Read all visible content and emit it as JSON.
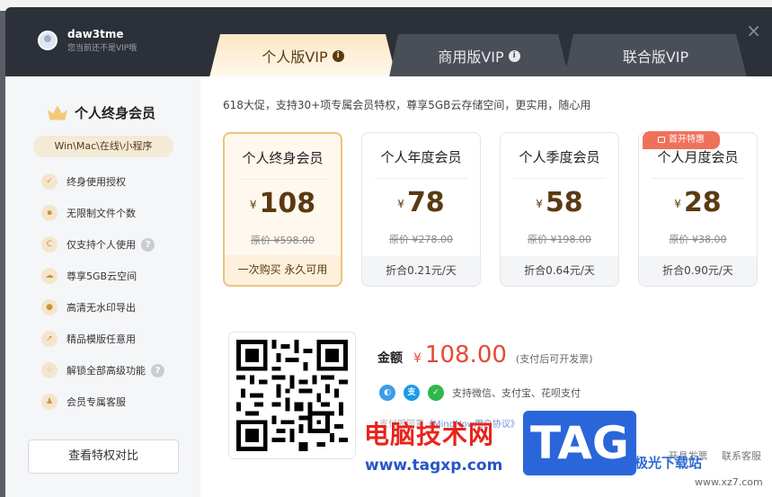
{
  "user": {
    "name": "daw3tme",
    "status": "您当前还不是VIP哦"
  },
  "tabs": [
    {
      "label": "个人版VIP",
      "info": "i"
    },
    {
      "label": "商用版VIP",
      "info": "i"
    },
    {
      "label": "联合版VIP"
    }
  ],
  "close_label": "×",
  "sidebar": {
    "title": "个人终身会员",
    "platform": "Win\\Mac\\在线\\小程序",
    "features": [
      {
        "label": "终身使用授权",
        "icon": "shield-check-icon",
        "help": false
      },
      {
        "label": "无限制文件个数",
        "icon": "lock-icon",
        "help": false
      },
      {
        "label": "仅支持个人使用",
        "icon": "copyright-icon",
        "help": true
      },
      {
        "label": "尊享5GB云空间",
        "icon": "cloud-icon",
        "help": false
      },
      {
        "label": "高清无水印导出",
        "icon": "drop-icon",
        "help": false
      },
      {
        "label": "精品模版任意用",
        "icon": "rocket-icon",
        "help": false
      },
      {
        "label": "解锁全部高级功能",
        "icon": "grid-icon",
        "help": true
      },
      {
        "label": "会员专属客服",
        "icon": "user-icon",
        "help": false
      }
    ],
    "help_mark": "?",
    "compare_button": "查看特权对比"
  },
  "promo": "618大促，支持30+项专属会员特权，尊享5GB云存储空间，更实用，随心用",
  "currency": "¥",
  "plans": [
    {
      "name": "个人终身会员",
      "price": "108",
      "original": "原价 ¥598.00",
      "footer": "一次购买 永久可用",
      "selected": true
    },
    {
      "name": "个人年度会员",
      "price": "78",
      "original": "原价 ¥278.00",
      "footer": "折合0.21元/天",
      "selected": false
    },
    {
      "name": "个人季度会员",
      "price": "58",
      "original": "原价 ¥198.00",
      "footer": "折合0.64元/天",
      "selected": false
    },
    {
      "name": "个人月度会员",
      "price": "28",
      "original": "原价 ¥38.00",
      "footer": "折合0.90元/天",
      "selected": false
    }
  ],
  "badge": "首开特惠",
  "payment": {
    "amount_label": "金额",
    "currency": "¥",
    "amount": "108.00",
    "invoice_note": "(支付后可开发票)",
    "methods_text": "支持微信、支付宝、花呗支付",
    "agreement_prefix": "支付即同意",
    "agreement_link": "《MindNow用户协议》"
  },
  "help_links": [
    "开具发票",
    "联系客服"
  ],
  "watermark": {
    "cn_text": "电脑技术网",
    "url": "www.tagxp.com",
    "tag": "TAG",
    "site_name": "极光下载站",
    "site_url": "www.xz7.com"
  },
  "colors": {
    "accent_gold": "#efc27e",
    "price_red": "#e54935",
    "dark_header": "#2c3038"
  }
}
